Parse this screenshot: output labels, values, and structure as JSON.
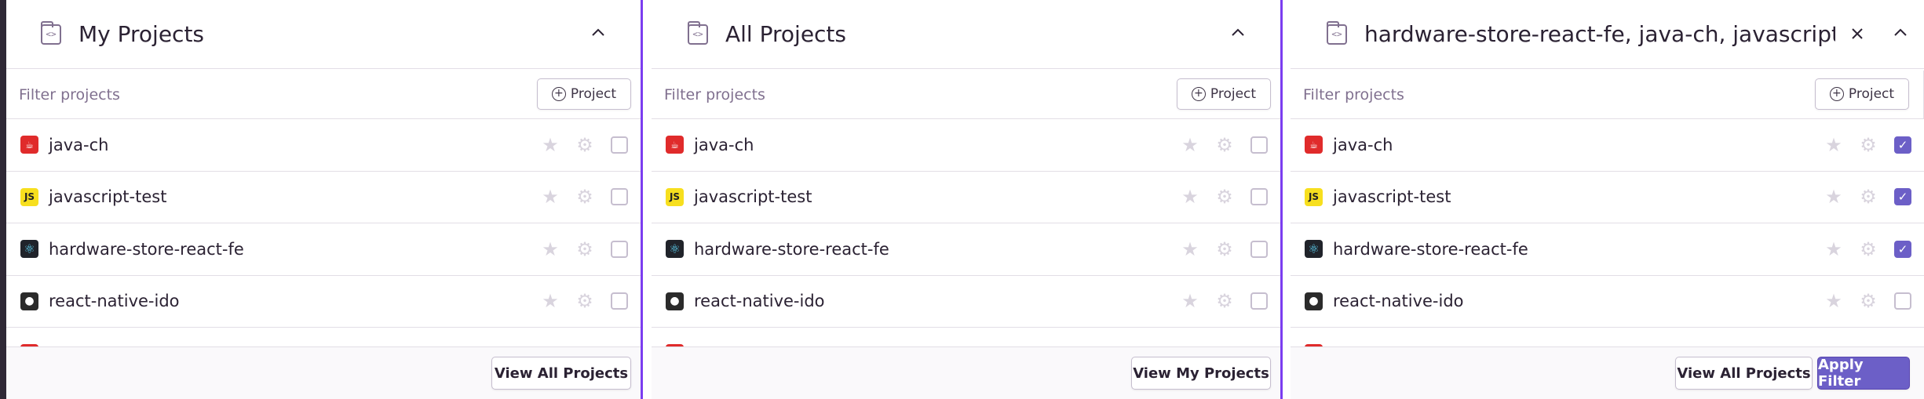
{
  "panels": [
    {
      "title": "My Projects",
      "filter_placeholder": "Filter projects",
      "project_button": "Project",
      "projects": [
        {
          "name": "java-ch",
          "icon": "java-icon",
          "checked": false
        },
        {
          "name": "javascript-test",
          "icon": "javascript-icon",
          "checked": false
        },
        {
          "name": "hardware-store-react-fe",
          "icon": "react-icon",
          "checked": false
        },
        {
          "name": "react-native-ido",
          "icon": "apple-icon",
          "checked": false
        }
      ],
      "footer_button": "View All Projects"
    },
    {
      "title": "All Projects",
      "filter_placeholder": "Filter projects",
      "project_button": "Project",
      "projects": [
        {
          "name": "java-ch",
          "icon": "java-icon",
          "checked": false
        },
        {
          "name": "javascript-test",
          "icon": "javascript-icon",
          "checked": false
        },
        {
          "name": "hardware-store-react-fe",
          "icon": "react-icon",
          "checked": false
        },
        {
          "name": "react-native-ido",
          "icon": "apple-icon",
          "checked": false
        }
      ],
      "footer_button": "View My Projects"
    },
    {
      "title": "hardware-store-react-fe, java-ch, javascript-t...",
      "filter_placeholder": "Filter projects",
      "project_button": "Project",
      "projects": [
        {
          "name": "java-ch",
          "icon": "java-icon",
          "checked": true
        },
        {
          "name": "javascript-test",
          "icon": "javascript-icon",
          "checked": true
        },
        {
          "name": "hardware-store-react-fe",
          "icon": "react-icon",
          "checked": true
        },
        {
          "name": "react-native-ido",
          "icon": "apple-icon",
          "checked": false
        }
      ],
      "footer_button": "View All Projects",
      "apply_button": "Apply Filter"
    }
  ],
  "colors": {
    "accent": "#6c5fc7",
    "divider": "#7b3df0",
    "java": "#e02b2b",
    "javascript": "#f7df1e",
    "react": "#20232a",
    "apple": "#2b2b2b"
  }
}
